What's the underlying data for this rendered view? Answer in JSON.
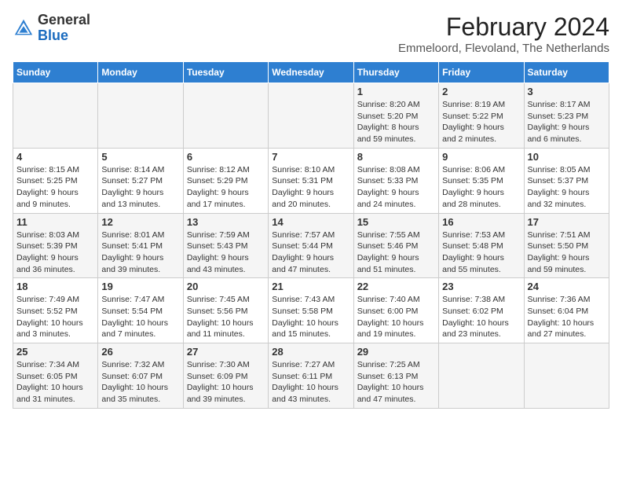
{
  "header": {
    "logo_general": "General",
    "logo_blue": "Blue",
    "month_year": "February 2024",
    "location": "Emmeloord, Flevoland, The Netherlands"
  },
  "days_of_week": [
    "Sunday",
    "Monday",
    "Tuesday",
    "Wednesday",
    "Thursday",
    "Friday",
    "Saturday"
  ],
  "weeks": [
    [
      {
        "day": "",
        "info": ""
      },
      {
        "day": "",
        "info": ""
      },
      {
        "day": "",
        "info": ""
      },
      {
        "day": "",
        "info": ""
      },
      {
        "day": "1",
        "info": "Sunrise: 8:20 AM\nSunset: 5:20 PM\nDaylight: 8 hours\nand 59 minutes."
      },
      {
        "day": "2",
        "info": "Sunrise: 8:19 AM\nSunset: 5:22 PM\nDaylight: 9 hours\nand 2 minutes."
      },
      {
        "day": "3",
        "info": "Sunrise: 8:17 AM\nSunset: 5:23 PM\nDaylight: 9 hours\nand 6 minutes."
      }
    ],
    [
      {
        "day": "4",
        "info": "Sunrise: 8:15 AM\nSunset: 5:25 PM\nDaylight: 9 hours\nand 9 minutes."
      },
      {
        "day": "5",
        "info": "Sunrise: 8:14 AM\nSunset: 5:27 PM\nDaylight: 9 hours\nand 13 minutes."
      },
      {
        "day": "6",
        "info": "Sunrise: 8:12 AM\nSunset: 5:29 PM\nDaylight: 9 hours\nand 17 minutes."
      },
      {
        "day": "7",
        "info": "Sunrise: 8:10 AM\nSunset: 5:31 PM\nDaylight: 9 hours\nand 20 minutes."
      },
      {
        "day": "8",
        "info": "Sunrise: 8:08 AM\nSunset: 5:33 PM\nDaylight: 9 hours\nand 24 minutes."
      },
      {
        "day": "9",
        "info": "Sunrise: 8:06 AM\nSunset: 5:35 PM\nDaylight: 9 hours\nand 28 minutes."
      },
      {
        "day": "10",
        "info": "Sunrise: 8:05 AM\nSunset: 5:37 PM\nDaylight: 9 hours\nand 32 minutes."
      }
    ],
    [
      {
        "day": "11",
        "info": "Sunrise: 8:03 AM\nSunset: 5:39 PM\nDaylight: 9 hours\nand 36 minutes."
      },
      {
        "day": "12",
        "info": "Sunrise: 8:01 AM\nSunset: 5:41 PM\nDaylight: 9 hours\nand 39 minutes."
      },
      {
        "day": "13",
        "info": "Sunrise: 7:59 AM\nSunset: 5:43 PM\nDaylight: 9 hours\nand 43 minutes."
      },
      {
        "day": "14",
        "info": "Sunrise: 7:57 AM\nSunset: 5:44 PM\nDaylight: 9 hours\nand 47 minutes."
      },
      {
        "day": "15",
        "info": "Sunrise: 7:55 AM\nSunset: 5:46 PM\nDaylight: 9 hours\nand 51 minutes."
      },
      {
        "day": "16",
        "info": "Sunrise: 7:53 AM\nSunset: 5:48 PM\nDaylight: 9 hours\nand 55 minutes."
      },
      {
        "day": "17",
        "info": "Sunrise: 7:51 AM\nSunset: 5:50 PM\nDaylight: 9 hours\nand 59 minutes."
      }
    ],
    [
      {
        "day": "18",
        "info": "Sunrise: 7:49 AM\nSunset: 5:52 PM\nDaylight: 10 hours\nand 3 minutes."
      },
      {
        "day": "19",
        "info": "Sunrise: 7:47 AM\nSunset: 5:54 PM\nDaylight: 10 hours\nand 7 minutes."
      },
      {
        "day": "20",
        "info": "Sunrise: 7:45 AM\nSunset: 5:56 PM\nDaylight: 10 hours\nand 11 minutes."
      },
      {
        "day": "21",
        "info": "Sunrise: 7:43 AM\nSunset: 5:58 PM\nDaylight: 10 hours\nand 15 minutes."
      },
      {
        "day": "22",
        "info": "Sunrise: 7:40 AM\nSunset: 6:00 PM\nDaylight: 10 hours\nand 19 minutes."
      },
      {
        "day": "23",
        "info": "Sunrise: 7:38 AM\nSunset: 6:02 PM\nDaylight: 10 hours\nand 23 minutes."
      },
      {
        "day": "24",
        "info": "Sunrise: 7:36 AM\nSunset: 6:04 PM\nDaylight: 10 hours\nand 27 minutes."
      }
    ],
    [
      {
        "day": "25",
        "info": "Sunrise: 7:34 AM\nSunset: 6:05 PM\nDaylight: 10 hours\nand 31 minutes."
      },
      {
        "day": "26",
        "info": "Sunrise: 7:32 AM\nSunset: 6:07 PM\nDaylight: 10 hours\nand 35 minutes."
      },
      {
        "day": "27",
        "info": "Sunrise: 7:30 AM\nSunset: 6:09 PM\nDaylight: 10 hours\nand 39 minutes."
      },
      {
        "day": "28",
        "info": "Sunrise: 7:27 AM\nSunset: 6:11 PM\nDaylight: 10 hours\nand 43 minutes."
      },
      {
        "day": "29",
        "info": "Sunrise: 7:25 AM\nSunset: 6:13 PM\nDaylight: 10 hours\nand 47 minutes."
      },
      {
        "day": "",
        "info": ""
      },
      {
        "day": "",
        "info": ""
      }
    ]
  ]
}
